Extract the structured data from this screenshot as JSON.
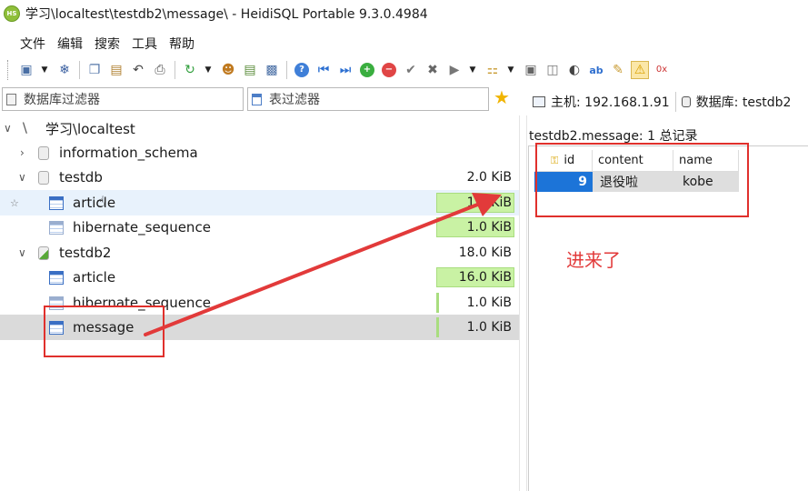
{
  "window": {
    "title": "学习\\localtest\\testdb2\\message\\ - HeidiSQL Portable 9.3.0.4984",
    "icon_text": "HS"
  },
  "menu": [
    "文件",
    "编辑",
    "搜索",
    "工具",
    "帮助"
  ],
  "filters": {
    "database": "数据库过滤器",
    "table": "表过滤器"
  },
  "tabs": {
    "host": "主机: 192.168.1.91",
    "database": "数据库: testdb2"
  },
  "tree": {
    "session": "学习\\localtest",
    "databases": [
      {
        "name": "information_schema",
        "size": "",
        "expanded": false
      },
      {
        "name": "testdb",
        "size": "2.0 KiB",
        "expanded": true,
        "tables": [
          {
            "name": "article",
            "size": "1.0 KiB"
          },
          {
            "name": "hibernate_sequence",
            "size": "1.0 KiB"
          }
        ]
      },
      {
        "name": "testdb2",
        "size": "18.0 KiB",
        "expanded": true,
        "tables": [
          {
            "name": "article",
            "size": "16.0 KiB",
            "fill": 1.0
          },
          {
            "name": "hibernate_sequence",
            "size": "1.0 KiB",
            "fill": 0.06
          },
          {
            "name": "message",
            "size": "1.0 KiB",
            "fill": 0.06
          }
        ]
      }
    ]
  },
  "grid": {
    "caption": "testdb2.message: 1 总记录",
    "columns": [
      "id",
      "content",
      "name"
    ],
    "rows": [
      [
        "9",
        "退役啦",
        "kobe"
      ]
    ]
  },
  "annotation": {
    "text": "进来了",
    "color": "#e23a3a"
  }
}
